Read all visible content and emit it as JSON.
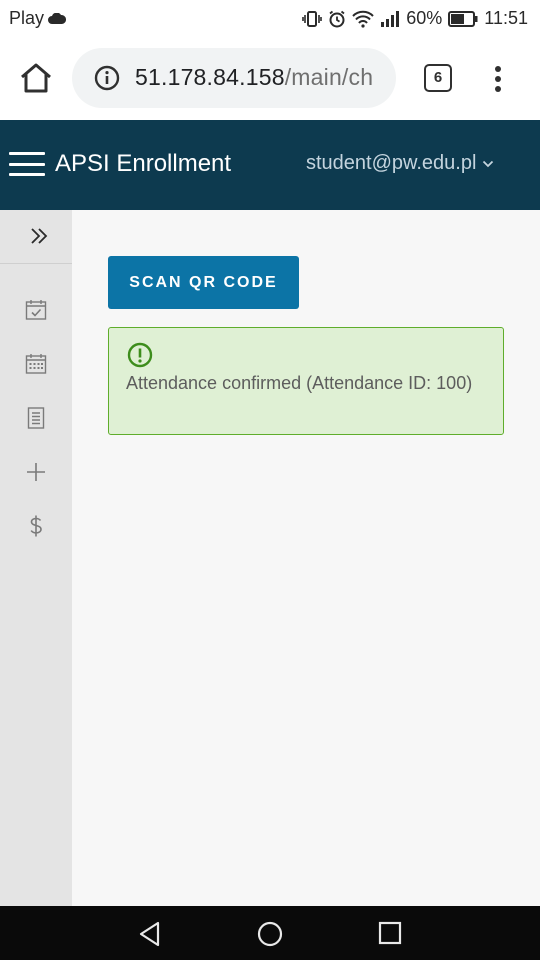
{
  "status_bar": {
    "carrier": "Play",
    "battery": "60%",
    "time": "11:51",
    "icons": [
      "cloud-icon",
      "vibrate-icon",
      "alarm-icon",
      "wifi-icon",
      "signal-icon",
      "battery-icon"
    ]
  },
  "browser": {
    "url_host": "51.178.84.158",
    "url_path": "/main/ch",
    "tab_count": "6",
    "icons": [
      "home-icon",
      "info-icon",
      "more-vert-icon"
    ]
  },
  "app": {
    "title": "APSI Enrollment",
    "user": "student@pw.edu.pl"
  },
  "sidebar": {
    "items": [
      {
        "icon": "calendar-check-icon"
      },
      {
        "icon": "calendar-grid-icon"
      },
      {
        "icon": "document-icon"
      },
      {
        "icon": "plus-icon"
      },
      {
        "icon": "dollar-icon"
      }
    ]
  },
  "main": {
    "scan_button": "SCAN QR CODE",
    "alert_message": "Attendance confirmed (Attendance ID: 100)"
  },
  "colors": {
    "header_bg": "#0d3a4f",
    "button_bg": "#0c74a6",
    "alert_bg": "#dff0d4",
    "alert_border": "#5fad2b"
  }
}
